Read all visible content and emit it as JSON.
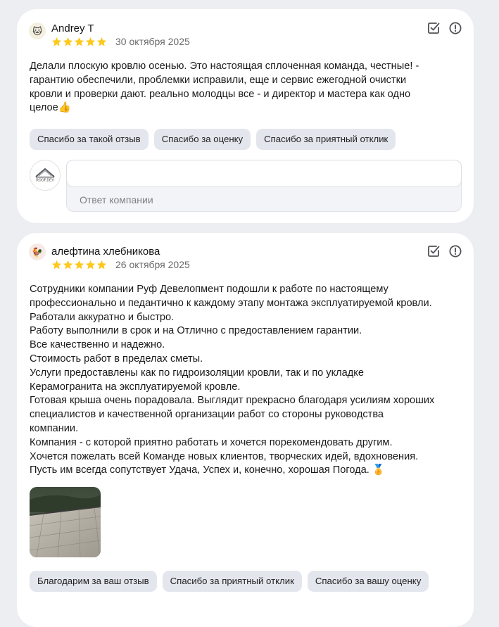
{
  "reviews": [
    {
      "author": "Andrey T",
      "date": "30 октября 2025",
      "rating": 5,
      "avatar_icon": "cat-emoji-icon",
      "text": "Делали плоскую кровлю осенью. Это настоящая сплоченная команда, честные! -\nгарантию обеспечили, проблемки исправили, еще и сервис ежегодной очистки\nкровли и проверки дают. реально молодцы все - и директор и мастера как одно\nцелое👍",
      "quick_replies": [
        "Спасибо за такой отзыв",
        "Спасибо за оценку",
        "Спасибо за приятный отклик"
      ],
      "reply_label": "Ответ компании",
      "company_logo_text": "ROOF.DEV"
    },
    {
      "author": "алефтина хлебникова",
      "date": "26 октября 2025",
      "rating": 5,
      "avatar_icon": "rooster-emoji-icon",
      "text": "Сотрудники компании Руф Девелопмент подошли к работе по настоящему\nпрофессионально и педантично к каждому этапу монтажа эксплуатируемой кровли.\nРаботали аккуратно и быстро.\nРаботу выполнили в срок и на Отлично с предоставлением гарантии.\nВсе качественно и надежно.\nСтоимость работ в пределах сметы.\nУслуги предоставлены как по гидроизоляции кровли, так и по укладке\nКерамогранита на эксплуатируемой кровле.\nГотовая крыша очень порадовала. Выглядит прекрасно благодаря усилиям хороших\nспециалистов и качественной организации работ со стороны руководства\nкомпании.\nКомпания - с которой приятно работать и хочется порекомендовать другим.\nХочется пожелать всей Команде новых клиентов, творческих идей, вдохновения.\nПусть им всегда сопутствует Удача, Успех и, конечно, хорошая Погода. 🏅",
      "quick_replies": [
        "Благодарим за ваш отзыв",
        "Спасибо за приятный отклик",
        "Спасибо за вашу оценку"
      ]
    }
  ],
  "colors": {
    "star": "#fcc91c",
    "chip_bg": "#e4e6ee",
    "page_bg": "#eceef2"
  }
}
